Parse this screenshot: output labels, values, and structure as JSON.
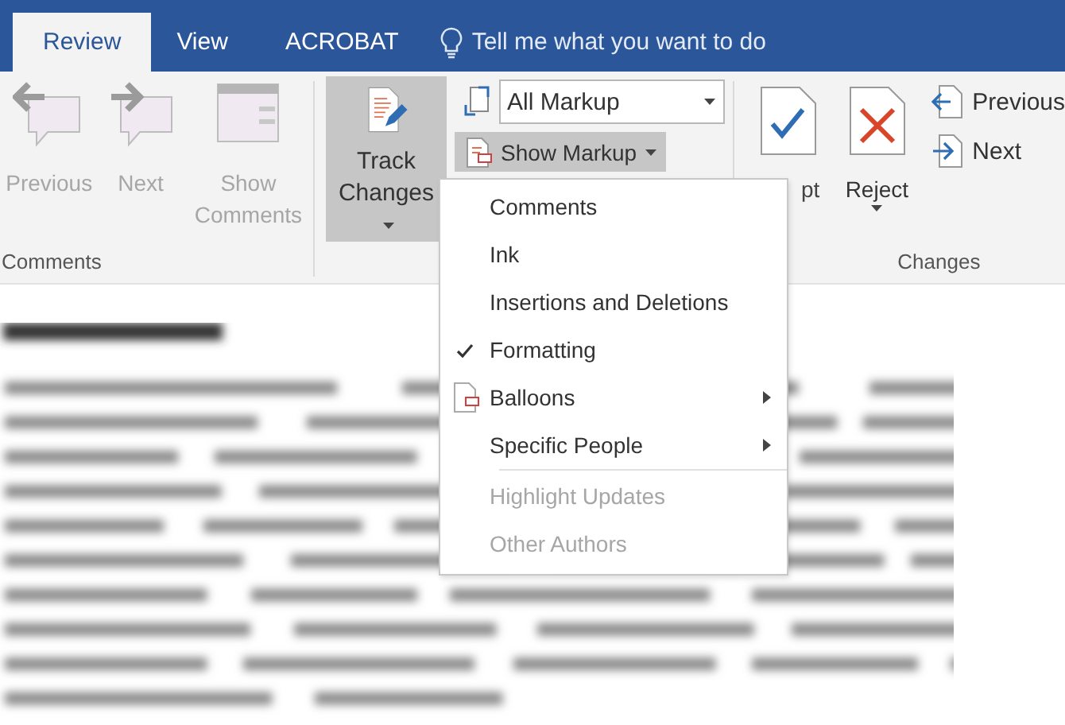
{
  "tabs": [
    {
      "label": "Review",
      "selected": true
    },
    {
      "label": "View",
      "selected": false
    },
    {
      "label": "ACROBAT",
      "selected": false
    }
  ],
  "tell_me": {
    "placeholder": "Tell me what you want to do"
  },
  "comments_group": {
    "label": "Comments",
    "buttons": [
      {
        "kind": "previous",
        "label": "Previous",
        "disabled": true
      },
      {
        "kind": "next",
        "label": "Next",
        "disabled": true
      },
      {
        "kind": "show",
        "label": "Show Comments",
        "disabled": true
      }
    ]
  },
  "tracking_group": {
    "track_changes": {
      "label": "Track Changes",
      "on": true
    },
    "markup_dropdown": {
      "value": "All Markup"
    },
    "show_markup": {
      "label": "Show Markup",
      "expanded": true
    }
  },
  "changes_group": {
    "label": "Changes",
    "accept": {
      "label": "pt"
    },
    "reject": {
      "label": "Reject"
    },
    "previous": {
      "label": "Previous"
    },
    "next": {
      "label": "Next"
    }
  },
  "show_markup_menu": [
    {
      "label": "Comments",
      "kind": "option",
      "checked": false,
      "disabled": false
    },
    {
      "label": "Ink",
      "kind": "option",
      "checked": false,
      "disabled": false
    },
    {
      "label": "Insertions and Deletions",
      "kind": "option",
      "checked": false,
      "disabled": false
    },
    {
      "label": "Formatting",
      "kind": "option",
      "checked": true,
      "disabled": false
    },
    {
      "label": "Balloons",
      "kind": "icon-submenu",
      "checked": false,
      "disabled": false
    },
    {
      "label": "Specific People",
      "kind": "submenu",
      "checked": false,
      "disabled": false
    },
    {
      "kind": "separator"
    },
    {
      "label": "Highlight Updates",
      "kind": "option",
      "checked": false,
      "disabled": true
    },
    {
      "label": "Other Authors",
      "kind": "option",
      "checked": false,
      "disabled": true
    }
  ]
}
